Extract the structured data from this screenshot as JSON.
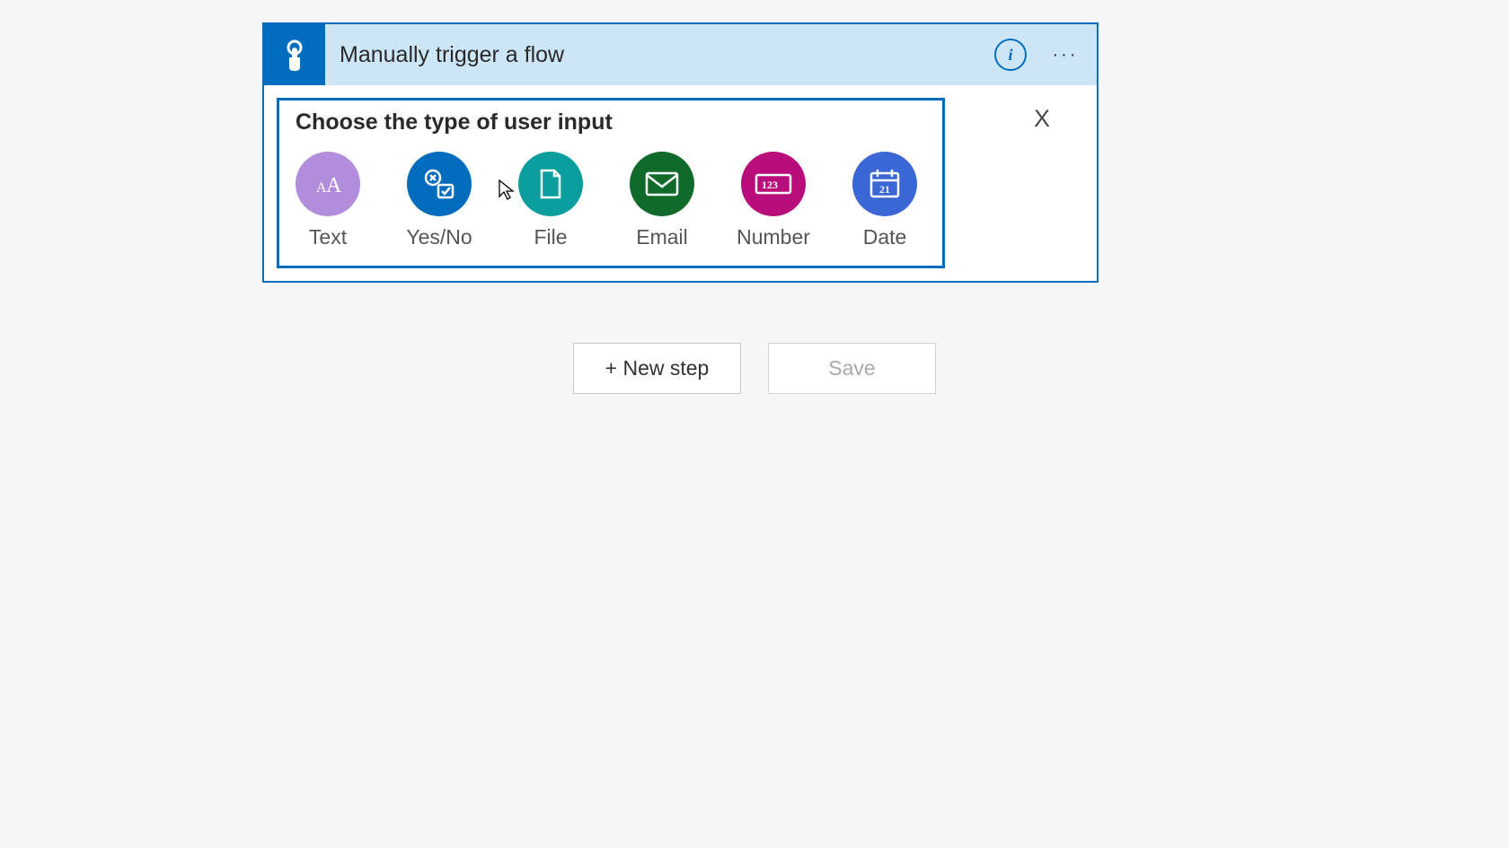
{
  "trigger": {
    "title": "Manually trigger a flow",
    "info_glyph": "i",
    "more_glyph": "···"
  },
  "panel": {
    "heading": "Choose the type of user input",
    "close_label": "X",
    "options": {
      "text": "Text",
      "yesno": "Yes/No",
      "file": "File",
      "email": "Email",
      "number": "Number",
      "date": "Date"
    }
  },
  "actions": {
    "new_step": "+ New step",
    "save": "Save"
  }
}
